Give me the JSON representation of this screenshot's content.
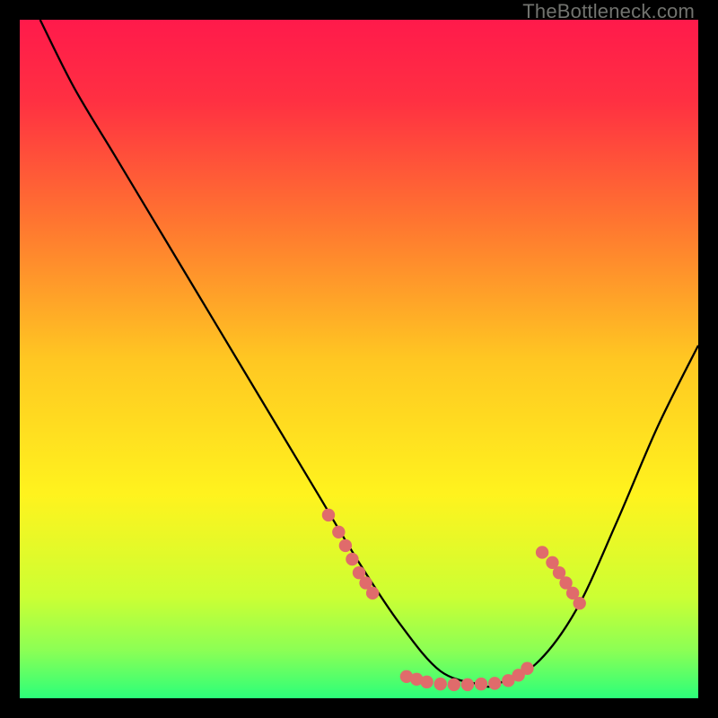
{
  "watermark": "TheBottleneck.com",
  "chart_data": {
    "type": "line",
    "title": "",
    "xlabel": "",
    "ylabel": "",
    "xlim": [
      0,
      100
    ],
    "ylim": [
      0,
      100
    ],
    "grid": false,
    "background_gradient": {
      "stops": [
        {
          "offset": 0.0,
          "color": "#ff1a4b"
        },
        {
          "offset": 0.12,
          "color": "#ff3042"
        },
        {
          "offset": 0.3,
          "color": "#ff7630"
        },
        {
          "offset": 0.5,
          "color": "#ffc722"
        },
        {
          "offset": 0.7,
          "color": "#fff31e"
        },
        {
          "offset": 0.85,
          "color": "#ccff33"
        },
        {
          "offset": 0.93,
          "color": "#8bff55"
        },
        {
          "offset": 1.0,
          "color": "#2bff7a"
        }
      ]
    },
    "series": [
      {
        "name": "curve",
        "style": "solid-black",
        "x": [
          3,
          8,
          14,
          20,
          26,
          32,
          38,
          44,
          50,
          56,
          62,
          68,
          70,
          76,
          82,
          88,
          94,
          100
        ],
        "values": [
          100,
          90,
          80,
          70,
          60,
          50,
          40,
          30,
          20,
          11,
          4,
          2,
          2,
          5,
          13,
          26,
          40,
          52
        ]
      },
      {
        "name": "right-upper-highlight-dots",
        "style": "dots-salmon",
        "x": [
          77,
          78.5,
          79.5,
          80.5,
          81.5,
          82.5
        ],
        "values": [
          21.5,
          20,
          18.5,
          17,
          15.5,
          14
        ]
      },
      {
        "name": "left-upper-highlight-dots",
        "style": "dots-salmon",
        "x": [
          45.5,
          47,
          48,
          49,
          50,
          51,
          52
        ],
        "values": [
          27,
          24.5,
          22.5,
          20.5,
          18.5,
          17,
          15.5
        ]
      },
      {
        "name": "valley-highlight-dots",
        "style": "dots-salmon",
        "x": [
          57,
          58.5,
          60,
          62,
          64,
          66,
          68,
          70,
          72,
          73.5,
          74.8
        ],
        "values": [
          3.2,
          2.8,
          2.4,
          2.1,
          2.0,
          2.0,
          2.1,
          2.2,
          2.6,
          3.4,
          4.4
        ]
      }
    ]
  }
}
